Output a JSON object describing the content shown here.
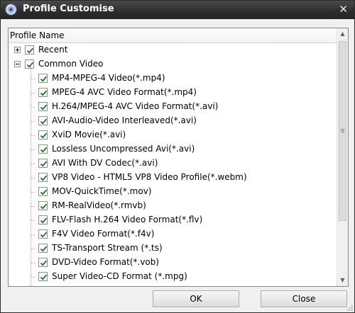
{
  "window": {
    "title": "Profile Customise",
    "close_glyph": "✕"
  },
  "list": {
    "column_header": "Profile Name",
    "groups": [
      {
        "label": "Recent",
        "checked": true,
        "expanded": false
      },
      {
        "label": "Common Video",
        "checked": true,
        "expanded": true
      }
    ],
    "items": [
      "MP4-MPEG-4 Video(*.mp4)",
      "MPEG-4 AVC Video Format(*.mp4)",
      "H.264/MPEG-4 AVC Video Format(*.avi)",
      "AVI-Audio-Video Interleaved(*.avi)",
      "XviD Movie(*.avi)",
      "Lossless Uncompressed Avi(*.avi)",
      "AVI With DV Codec(*.avi)",
      "VP8 Video - HTML5 VP8 Video Profile(*.webm)",
      "MOV-QuickTime(*.mov)",
      "RM-RealVideo(*.rmvb)",
      "FLV-Flash H.264 Video Format(*.flv)",
      "F4V Video Format(*.f4v)",
      "TS-Transport Stream (*.ts)",
      "DVD-Video Format(*.vob)",
      "Super Video-CD Format (*.mpg)"
    ]
  },
  "buttons": {
    "ok": "OK",
    "close": "Close"
  },
  "colors": {
    "titlebar": "#2e2e2e",
    "check": "#1e6e1e"
  }
}
